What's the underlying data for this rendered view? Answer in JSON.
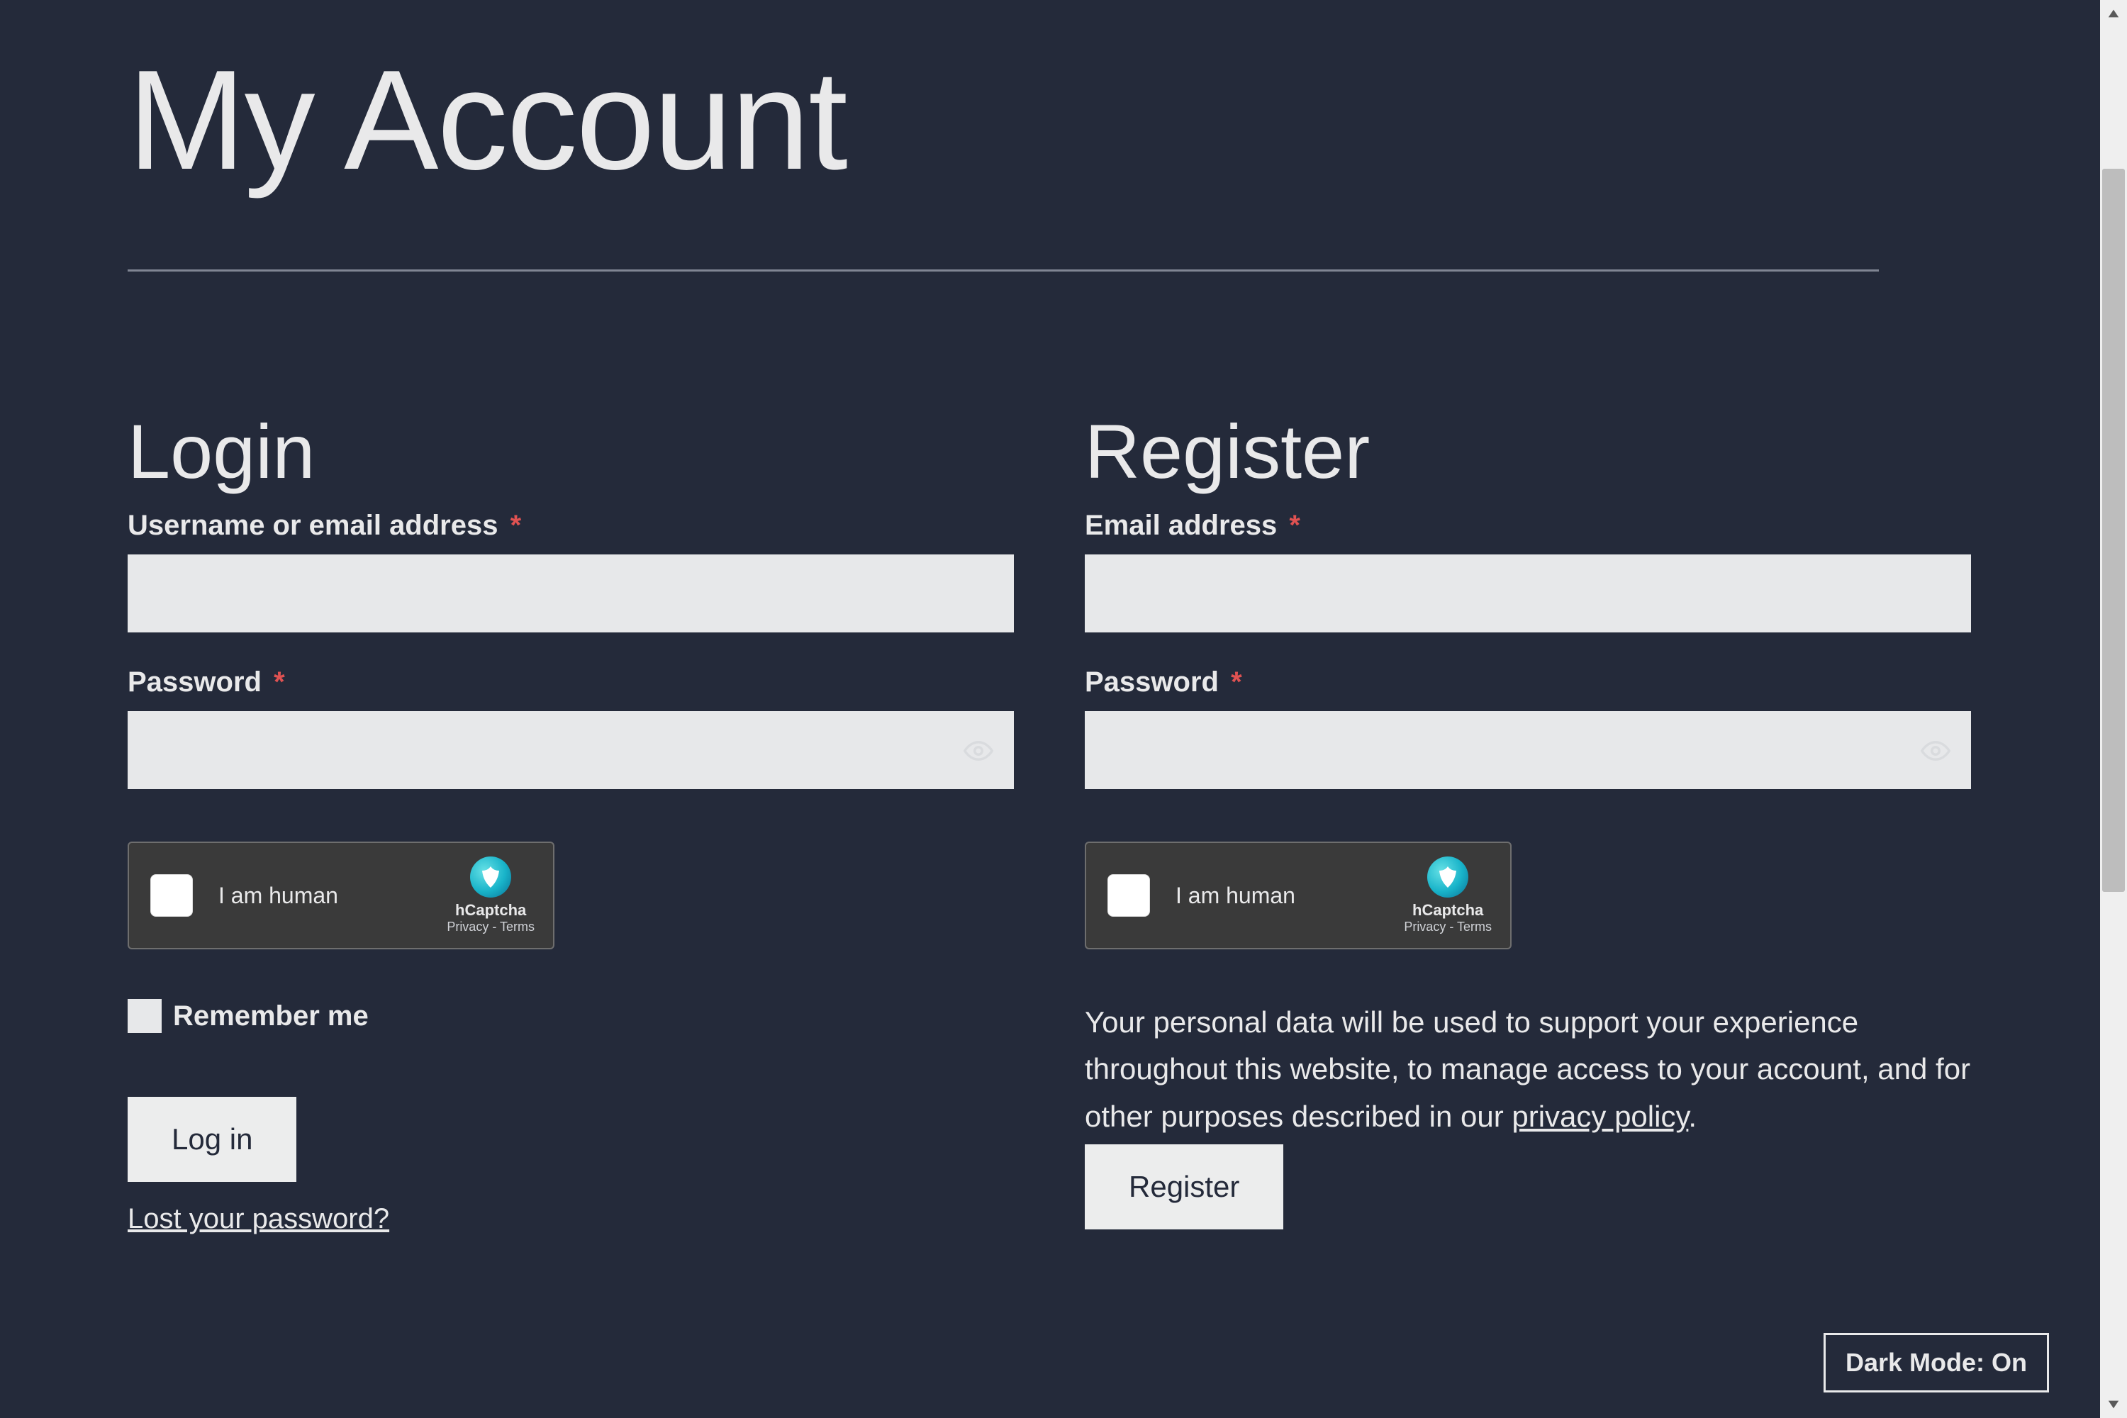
{
  "page": {
    "title": "My Account"
  },
  "login": {
    "heading": "Login",
    "username_label": "Username or email address",
    "password_label": "Password",
    "required_marker": "*",
    "remember_label": "Remember me",
    "submit_label": "Log in",
    "lost_password_label": "Lost your password?"
  },
  "register": {
    "heading": "Register",
    "email_label": "Email address",
    "password_label": "Password",
    "required_marker": "*",
    "privacy_text_1": "Your personal data will be used to support your experience throughout this website, to manage access to your account, and for other purposes described in our ",
    "privacy_link_label": "privacy policy",
    "privacy_text_2": ".",
    "submit_label": "Register"
  },
  "hcaptcha": {
    "text": "I am human",
    "brand": "hCaptcha",
    "privacy": "Privacy",
    "separator": " - ",
    "terms": "Terms"
  },
  "darkmode": {
    "label": "Dark Mode: On"
  }
}
